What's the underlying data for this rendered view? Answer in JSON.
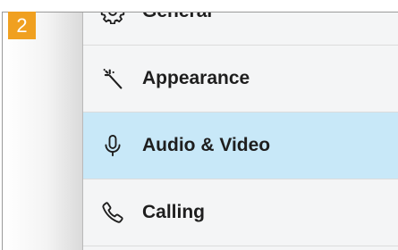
{
  "step_badge": "2",
  "colors": {
    "badge": "#f0a020",
    "selected_row": "#c8e8f8"
  },
  "settings_menu": {
    "items": [
      {
        "label": "General",
        "icon": "gear-icon",
        "selected": false
      },
      {
        "label": "Appearance",
        "icon": "magic-wand-icon",
        "selected": false
      },
      {
        "label": "Audio & Video",
        "icon": "microphone-icon",
        "selected": true
      },
      {
        "label": "Calling",
        "icon": "phone-icon",
        "selected": false
      }
    ]
  }
}
